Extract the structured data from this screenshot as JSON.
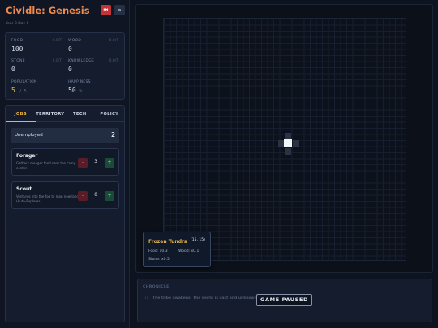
{
  "header": {
    "title": "CivIdle: Genesis",
    "year_day": "Year 0 Day 0",
    "play_icon": "skip-back-icon",
    "speed_icon": "fast-forward-icon"
  },
  "resources": {
    "food": {
      "label": "FOOD",
      "rate": "0.0/T",
      "value": "100"
    },
    "wood": {
      "label": "WOOD",
      "rate": "0.0/T",
      "value": "0"
    },
    "stone": {
      "label": "STONE",
      "rate": "0.0/T",
      "value": "0"
    },
    "knowledge": {
      "label": "KNOWLEDGE",
      "rate": "0.0/T",
      "value": "0"
    },
    "population": {
      "label": "POPULATION",
      "value": "5",
      "max": "/ 5"
    },
    "happiness": {
      "label": "HAPPINESS",
      "value": "50",
      "unit": "%"
    }
  },
  "tabs": [
    {
      "label": "JOBS"
    },
    {
      "label": "TERRITORY"
    },
    {
      "label": "TECH"
    },
    {
      "label": "POLICY"
    }
  ],
  "jobs": {
    "unemployed_label": "Unemployed",
    "unemployed_count": "2",
    "items": [
      {
        "name": "Forager",
        "desc": "Gathers meager food near the camp center.",
        "count": "3"
      },
      {
        "name": "Scout",
        "desc": "Ventures into the fog to map new lands (Auto-Explores).",
        "count": "0"
      }
    ],
    "minus": "-",
    "plus": "+"
  },
  "tooltip": {
    "name": "Frozen Tundra",
    "coords": "(15, 15)",
    "food": "Food: x0.3",
    "wood": "Wood: x0.1",
    "stone": "Stone: x0.5"
  },
  "chronicle": {
    "label": "CHRONICLE",
    "entries": [
      {
        "num": "01",
        "text": "The tribe awakens. The world is vast and unknown."
      }
    ]
  },
  "status": {
    "paused": "GAME PAUSED"
  },
  "colors": {
    "title": "#f08a4b",
    "accent": "#f0b63d",
    "population": "#e8c547",
    "danger": "#c23437",
    "success": "#1a4a38"
  }
}
